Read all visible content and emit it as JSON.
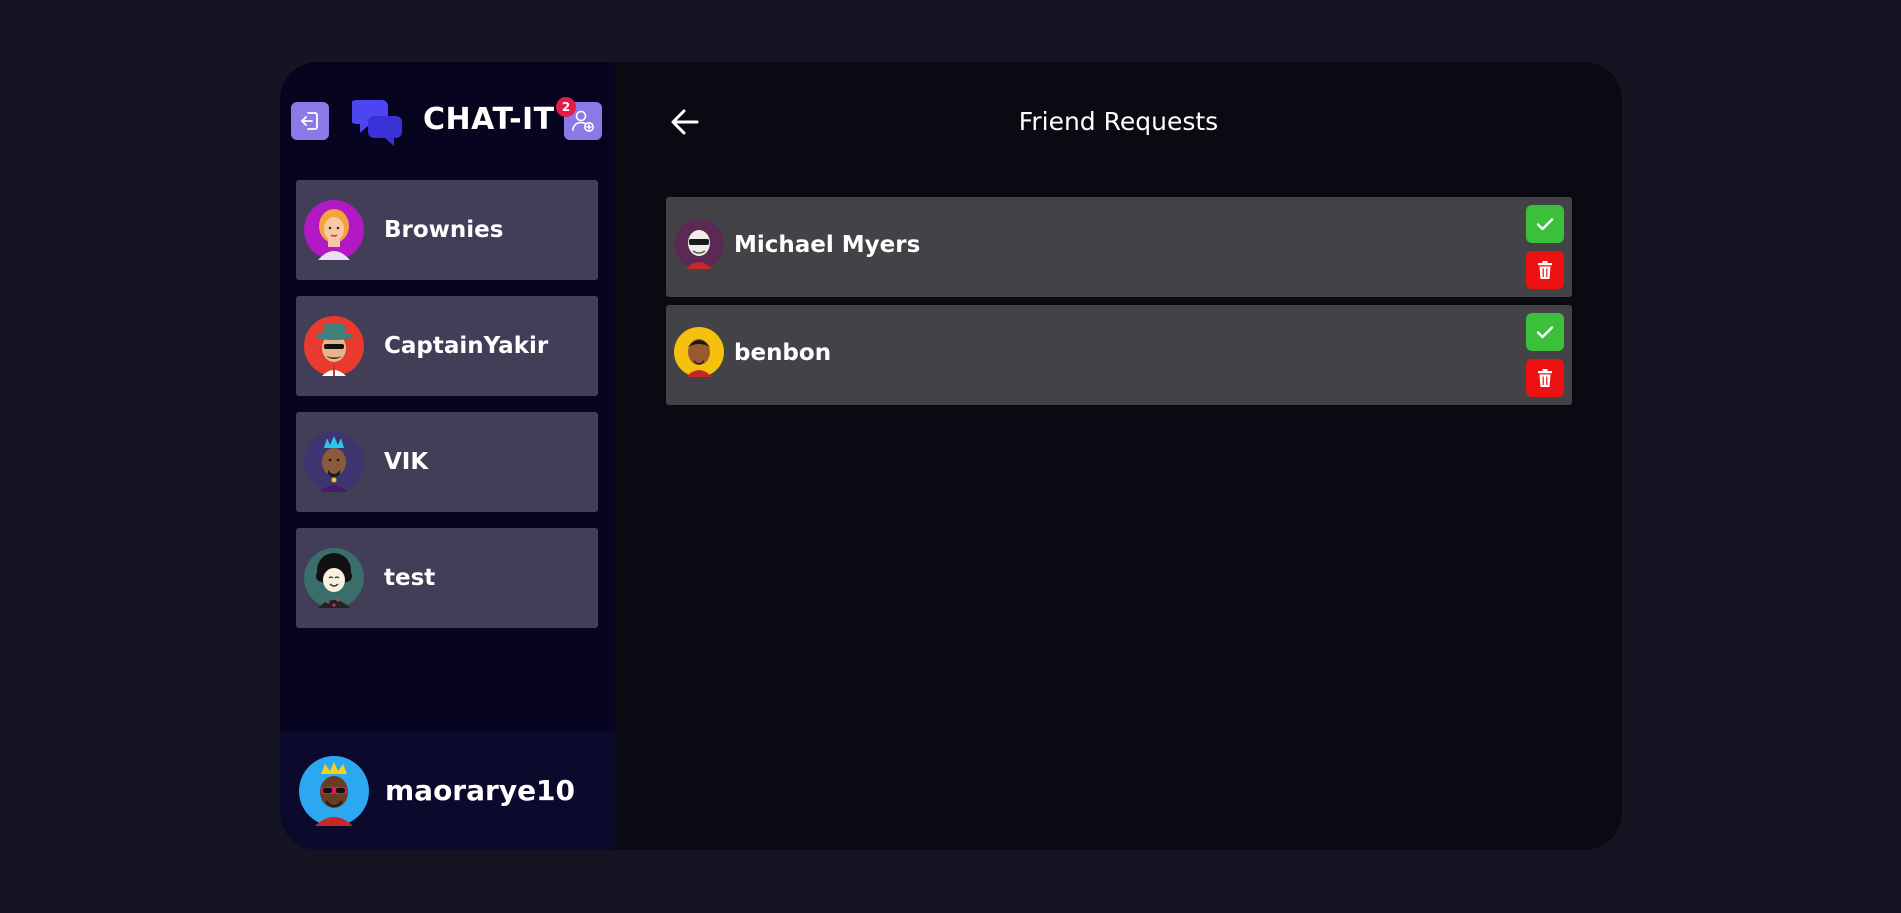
{
  "app": {
    "brand": "CHAT-IT",
    "notification_count": "2",
    "accent_color": "#8b7ae6"
  },
  "sidebar": {
    "contacts": [
      {
        "name": "Brownies"
      },
      {
        "name": "CaptainYakir"
      },
      {
        "name": "VIK"
      },
      {
        "name": "test"
      }
    ],
    "current_user": {
      "name": "maorarye10"
    }
  },
  "main": {
    "title": "Friend Requests",
    "requests": [
      {
        "name": "Michael Myers"
      },
      {
        "name": "benbon"
      }
    ]
  },
  "icons": {
    "logout": "logout-icon",
    "add_friend": "add-friend-icon",
    "back": "arrow-left-icon",
    "search": "search-icon",
    "accept": "check-icon",
    "decline": "trash-icon"
  },
  "colors": {
    "accept": "#3ac03a",
    "decline": "#ee1111",
    "badge": "#e11d48"
  }
}
